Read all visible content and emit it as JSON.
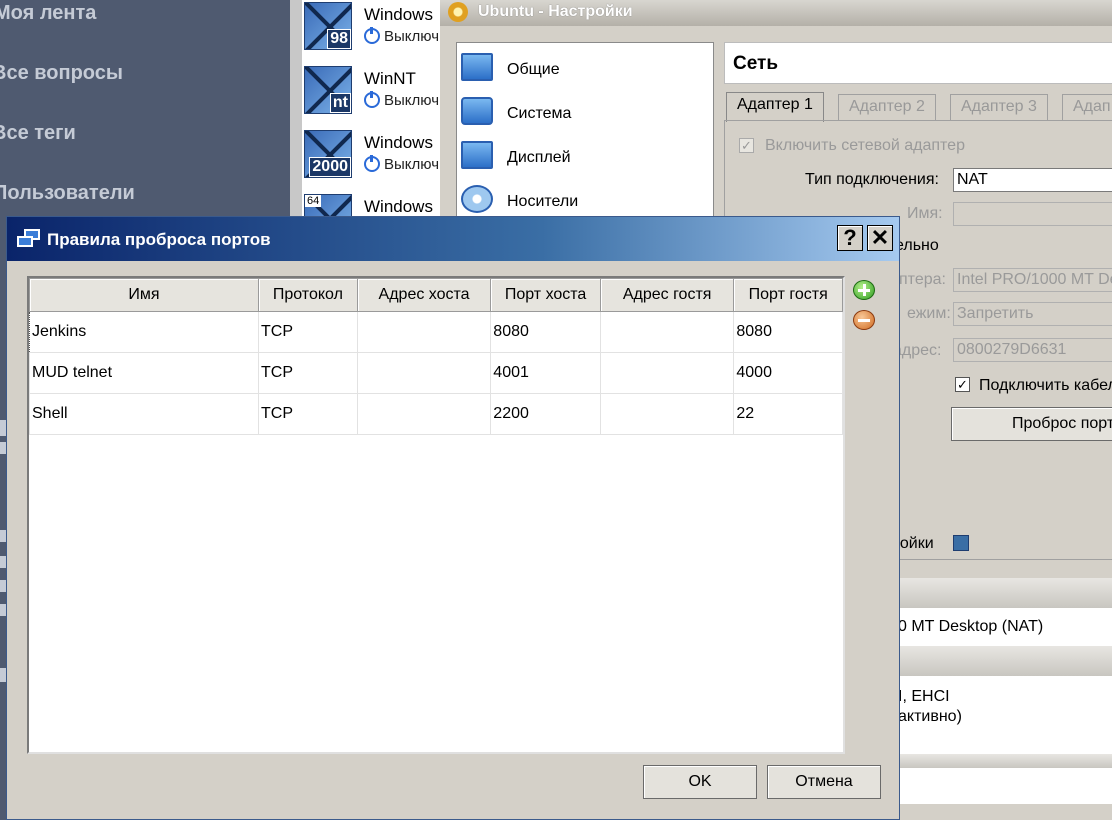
{
  "site_nav": {
    "items": [
      "Моя лента",
      "Все вопросы",
      "Все теги",
      "Пользователи"
    ]
  },
  "vm_list": {
    "items": [
      {
        "name": "Windows",
        "badge": "98",
        "state": "Выключ"
      },
      {
        "name": "WinNT",
        "badge": "nt",
        "state": "Выключ"
      },
      {
        "name": "Windows",
        "badge": "2000",
        "state": "Выключ"
      },
      {
        "name": "Windows",
        "badge": "64",
        "state": ""
      }
    ]
  },
  "settings": {
    "title": "Ubuntu - Настройки",
    "categories": [
      "Общие",
      "Система",
      "Дисплей",
      "Носители"
    ],
    "section_title": "Сеть",
    "tabs": [
      "Адаптер 1",
      "Адаптер 2",
      "Адаптер 3",
      "Адап"
    ],
    "enable_adapter_label": "Включить сетевой адаптер",
    "connection_type_label": "Тип подключения:",
    "connection_type_value": "NAT",
    "name_label": "Имя:",
    "name_value": "",
    "advanced_label_fragment": "ельно",
    "adapter_type_label_fragment": "птера:",
    "adapter_type_value": "Intel PRO/1000 MT De",
    "promisc_label_fragment": "ежим:",
    "promisc_value": "Запретить",
    "mac_label_fragment": "адрес:",
    "mac_value": "0800279D6631",
    "cable_label": "Подключить кабел",
    "port_forwarding_button": "Проброс порт",
    "settings_fragment": "ройки",
    "lower_line_1": "0 MT Desktop (NAT)",
    "lower_line_2": "I, EHCI",
    "lower_line_3": "активно)"
  },
  "dialog": {
    "title": "Правила проброса портов",
    "help_label": "?",
    "close_label": "✕",
    "columns": [
      "Имя",
      "Протокол",
      "Адрес хоста",
      "Порт хоста",
      "Адрес гостя",
      "Порт гостя"
    ],
    "rows": [
      {
        "name": "Jenkins",
        "protocol": "TCP",
        "host_ip": "",
        "host_port": "8080",
        "guest_ip": "",
        "guest_port": "8080"
      },
      {
        "name": "MUD telnet",
        "protocol": "TCP",
        "host_ip": "",
        "host_port": "4001",
        "guest_ip": "",
        "guest_port": "4000"
      },
      {
        "name": "Shell",
        "protocol": "TCP",
        "host_ip": "",
        "host_port": "2200",
        "guest_ip": "",
        "guest_port": "22"
      }
    ],
    "ok_label": "OK",
    "cancel_label": "Отмена",
    "add_icon": "add-rule-icon",
    "remove_icon": "remove-rule-icon"
  }
}
